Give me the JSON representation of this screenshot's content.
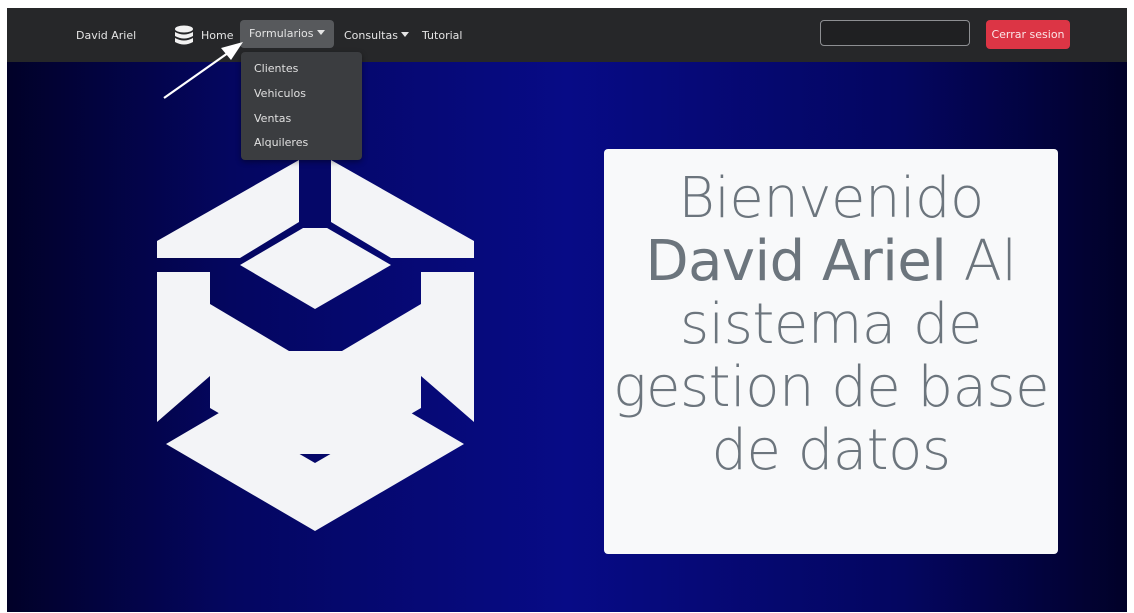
{
  "navbar": {
    "brand": "David Ariel",
    "db_icon": "database-icon",
    "home_label": "Home",
    "formularios_label": "Formularios",
    "consultas_label": "Consultas",
    "tutorial_label": "Tutorial",
    "search": {
      "value": "",
      "placeholder": ""
    },
    "logout_label": "Cerrar sesion"
  },
  "dropdown": {
    "items": [
      "Clientes",
      "Vehiculos",
      "Ventas",
      "Alquileres"
    ]
  },
  "welcome": {
    "line1": "Bienvenido",
    "name": "David Ariel",
    "line2_rest": "Al",
    "line3": "sistema de",
    "line4": "gestion de base",
    "line5": "de datos"
  },
  "icons": {
    "logo": "hexagon-cube-logo-icon",
    "annotation": "arrow-annotation-icon"
  },
  "colors": {
    "navbar_bg": "#262729",
    "active_item_bg": "#57595c",
    "danger": "#dc3545",
    "card_bg": "#f8f9fa",
    "card_text": "#6c757d",
    "bg_center": "#070b86"
  }
}
